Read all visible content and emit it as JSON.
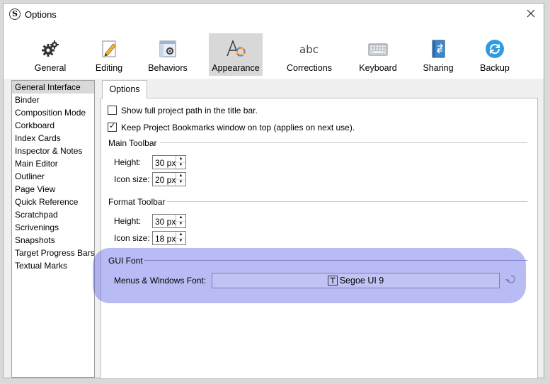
{
  "window": {
    "title": "Options"
  },
  "toolbar": {
    "buttons": [
      {
        "label": "General",
        "icon": "gears-icon"
      },
      {
        "label": "Editing",
        "icon": "pencil-paper-icon"
      },
      {
        "label": "Behaviors",
        "icon": "window-gear-icon"
      },
      {
        "label": "Appearance",
        "icon": "font-color-icon",
        "selected": true
      },
      {
        "label": "Corrections",
        "icon": "abc-icon"
      },
      {
        "label": "Keyboard",
        "icon": "keyboard-icon"
      },
      {
        "label": "Sharing",
        "icon": "binder-icon"
      },
      {
        "label": "Backup",
        "icon": "sync-icon"
      }
    ]
  },
  "sidebar": {
    "items": [
      "General Interface",
      "Binder",
      "Composition Mode",
      "Corkboard",
      "Index Cards",
      "Inspector & Notes",
      "Main Editor",
      "Outliner",
      "Page View",
      "Quick Reference",
      "Scratchpad",
      "Scrivenings",
      "Snapshots",
      "Target Progress Bars",
      "Textual Marks"
    ],
    "selected_index": 0
  },
  "tab": {
    "label": "Options"
  },
  "options": {
    "show_full_path": {
      "label": "Show full project path in the title bar.",
      "checked": false
    },
    "bookmarks_on_top": {
      "label": "Keep Project Bookmarks window on top (applies on next use).",
      "checked": true
    },
    "check_glyph": "✓"
  },
  "main_toolbar": {
    "title": "Main Toolbar",
    "height_label": "Height:",
    "height_value": "30 px",
    "icon_size_label": "Icon size:",
    "icon_size_value": "20 px"
  },
  "format_toolbar": {
    "title": "Format Toolbar",
    "height_label": "Height:",
    "height_value": "30 px",
    "icon_size_label": "Icon size:",
    "icon_size_value": "18 px"
  },
  "gui_font": {
    "title": "GUI Font",
    "menus_label": "Menus & Windows Font:",
    "font_value": "Segoe UI 9"
  },
  "spin_glyphs": {
    "up": "▲",
    "down": "▼"
  },
  "colors": {
    "highlight": "#4a4fe1",
    "selected_bg": "#d9d9d9",
    "backup_blue": "#2f9be0"
  }
}
